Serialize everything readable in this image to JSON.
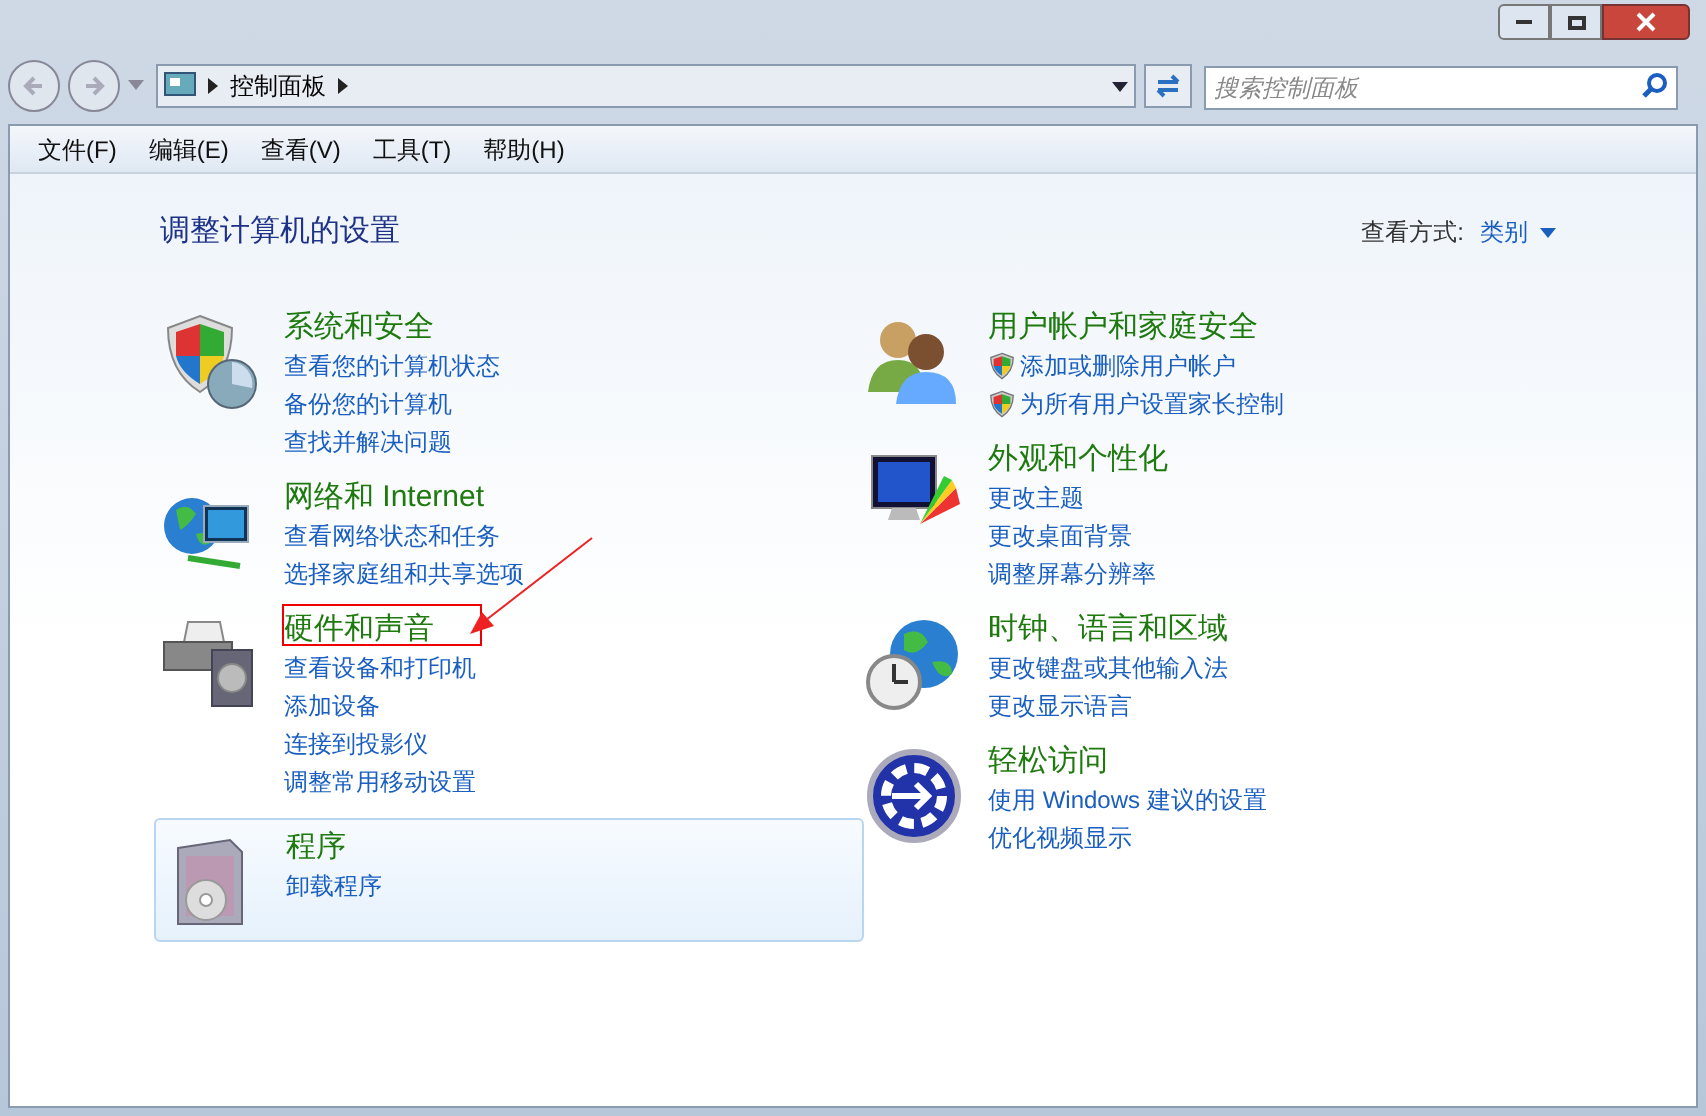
{
  "address_bar": {
    "path": "控制面板"
  },
  "search": {
    "placeholder": "搜索控制面板"
  },
  "menu": [
    "文件(F)",
    "编辑(E)",
    "查看(V)",
    "工具(T)",
    "帮助(H)"
  ],
  "heading": "调整计算机的设置",
  "view_by": {
    "label": "查看方式:",
    "value": "类别"
  },
  "columns": [
    [
      {
        "kind": "security",
        "title": "系统和安全",
        "selected": false,
        "annotated": false,
        "links": [
          {
            "text": "查看您的计算机状态",
            "shield": false
          },
          {
            "text": "备份您的计算机",
            "shield": false
          },
          {
            "text": "查找并解决问题",
            "shield": false
          }
        ]
      },
      {
        "kind": "network",
        "title": "网络和 Internet",
        "selected": false,
        "annotated": false,
        "links": [
          {
            "text": "查看网络状态和任务",
            "shield": false
          },
          {
            "text": "选择家庭组和共享选项",
            "shield": false
          }
        ]
      },
      {
        "kind": "hardware",
        "title": "硬件和声音",
        "selected": false,
        "annotated": true,
        "links": [
          {
            "text": "查看设备和打印机",
            "shield": false
          },
          {
            "text": "添加设备",
            "shield": false
          },
          {
            "text": "连接到投影仪",
            "shield": false
          },
          {
            "text": "调整常用移动设置",
            "shield": false
          }
        ]
      },
      {
        "kind": "programs",
        "title": "程序",
        "selected": true,
        "annotated": false,
        "links": [
          {
            "text": "卸载程序",
            "shield": false
          }
        ]
      }
    ],
    [
      {
        "kind": "users",
        "title": "用户帐户和家庭安全",
        "selected": false,
        "annotated": false,
        "links": [
          {
            "text": "添加或删除用户帐户",
            "shield": true
          },
          {
            "text": "为所有用户设置家长控制",
            "shield": true
          }
        ]
      },
      {
        "kind": "appearance",
        "title": "外观和个性化",
        "selected": false,
        "annotated": false,
        "links": [
          {
            "text": "更改主题",
            "shield": false
          },
          {
            "text": "更改桌面背景",
            "shield": false
          },
          {
            "text": "调整屏幕分辨率",
            "shield": false
          }
        ]
      },
      {
        "kind": "clock",
        "title": "时钟、语言和区域",
        "selected": false,
        "annotated": false,
        "links": [
          {
            "text": "更改键盘或其他输入法",
            "shield": false
          },
          {
            "text": "更改显示语言",
            "shield": false
          }
        ]
      },
      {
        "kind": "access",
        "title": "轻松访问",
        "selected": false,
        "annotated": false,
        "links": [
          {
            "text": "使用 Windows 建议的设置",
            "shield": false
          },
          {
            "text": "优化视频显示",
            "shield": false
          }
        ]
      }
    ]
  ]
}
